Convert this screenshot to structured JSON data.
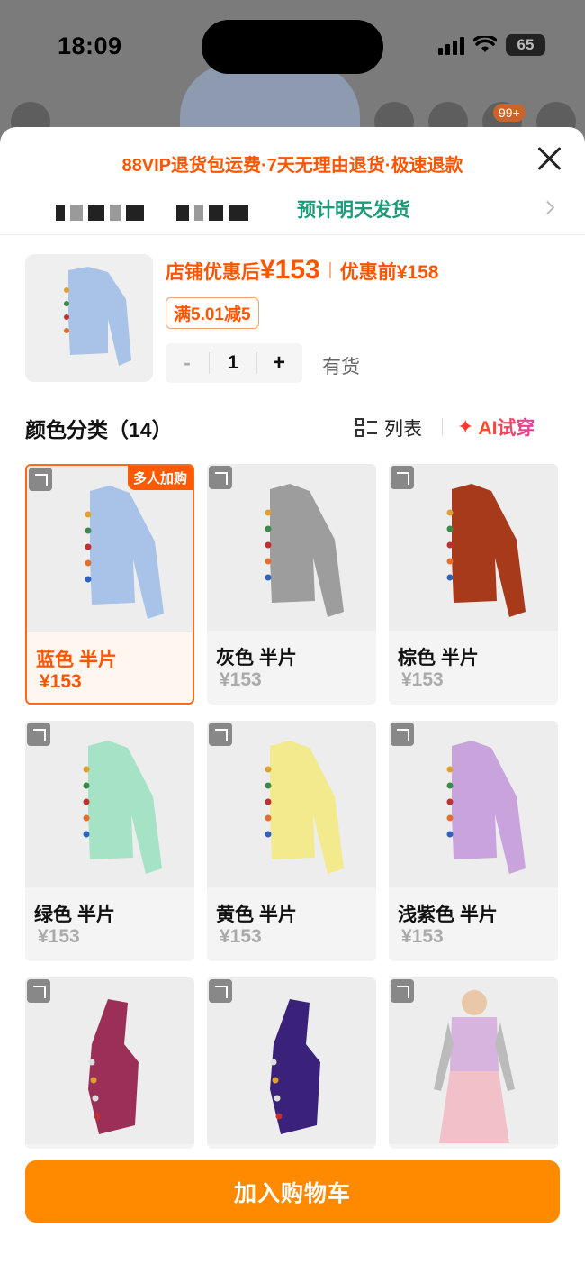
{
  "status_bar": {
    "time": "18:09",
    "battery": "65"
  },
  "background": {
    "badge": "99+"
  },
  "sheet": {
    "promo": "88VIP退货包运费·7天无理由退货·极速退款",
    "shipping": "预计明天发货"
  },
  "product": {
    "price_label": "店铺优惠后",
    "price_value": "¥153",
    "orig_label": "优惠前",
    "orig_value": "¥158",
    "coupon": "满5.01减5",
    "qty_minus": "-",
    "qty": "1",
    "qty_plus": "+",
    "stock": "有货"
  },
  "section": {
    "title": "颜色分类（14）",
    "list_label": "列表",
    "ai_star": "✦",
    "ai_label": "AI试穿"
  },
  "variants": [
    {
      "name": "蓝色 半片",
      "price": "¥153",
      "tag": "多人加购",
      "color": "#a9c3e8",
      "selected": true
    },
    {
      "name": "灰色 半片",
      "price": "¥153",
      "color": "#9d9d9d"
    },
    {
      "name": "棕色 半片",
      "price": "¥153",
      "color": "#a83a1c"
    },
    {
      "name": "绿色 半片",
      "price": "¥153",
      "color": "#a6e2c6"
    },
    {
      "name": "黄色 半片",
      "price": "¥153",
      "color": "#f2ea8c"
    },
    {
      "name": "浅紫色 半片",
      "price": "¥153",
      "color": "#c9a4dc"
    },
    {
      "name": "",
      "price": "",
      "color": "#9b2f58"
    },
    {
      "name": "",
      "price": "",
      "color": "#3a217a"
    },
    {
      "name": "",
      "price": "",
      "color": "#d7b4de"
    }
  ],
  "cart_button": "加入购物车",
  "colors": {
    "accent": "#ff5500",
    "cart": "#ff8a00",
    "shipping": "#1c9a7a"
  }
}
